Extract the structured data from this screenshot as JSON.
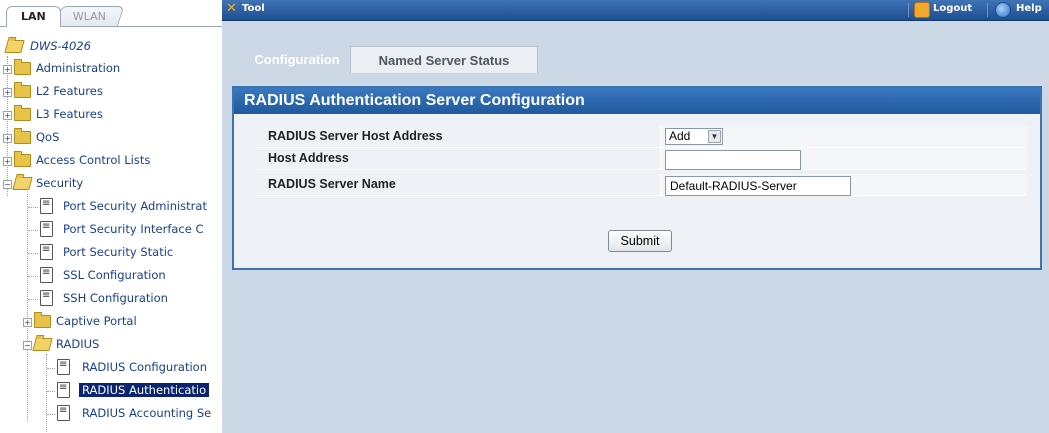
{
  "nav_tabs": {
    "lan": "LAN",
    "wlan": "WLAN"
  },
  "tree": {
    "root": "DWS-4026",
    "items": [
      {
        "label": "Administration"
      },
      {
        "label": "L2 Features"
      },
      {
        "label": "L3 Features"
      },
      {
        "label": "QoS"
      },
      {
        "label": "Access Control Lists"
      },
      {
        "label": "Security"
      },
      {
        "label": "Port Security Administrat"
      },
      {
        "label": "Port Security Interface C"
      },
      {
        "label": "Port Security Static"
      },
      {
        "label": "SSL Configuration"
      },
      {
        "label": "SSH Configuration"
      },
      {
        "label": "Captive Portal"
      },
      {
        "label": "RADIUS"
      },
      {
        "label": "RADIUS Configuration"
      },
      {
        "label": "RADIUS Authenticatio"
      },
      {
        "label": "RADIUS Accounting Se"
      }
    ]
  },
  "topbar": {
    "tool": "Tool",
    "logout": "Logout",
    "help": "Help"
  },
  "content_tabs": {
    "configuration": "Configuration",
    "named_server_status": "Named Server Status"
  },
  "panel": {
    "title": "RADIUS Authentication Server Configuration",
    "fields": [
      {
        "label": "RADIUS Server Host Address",
        "value": "Add"
      },
      {
        "label": "Host Address",
        "value": ""
      },
      {
        "label": "RADIUS Server Name",
        "value": "Default-RADIUS-Server"
      }
    ],
    "submit": "Submit"
  },
  "colors": {
    "topbar": "#1d4e91",
    "panel_header": "#2a67ae",
    "selected_tree": "#0a2470",
    "background": "#ccd8e6"
  }
}
